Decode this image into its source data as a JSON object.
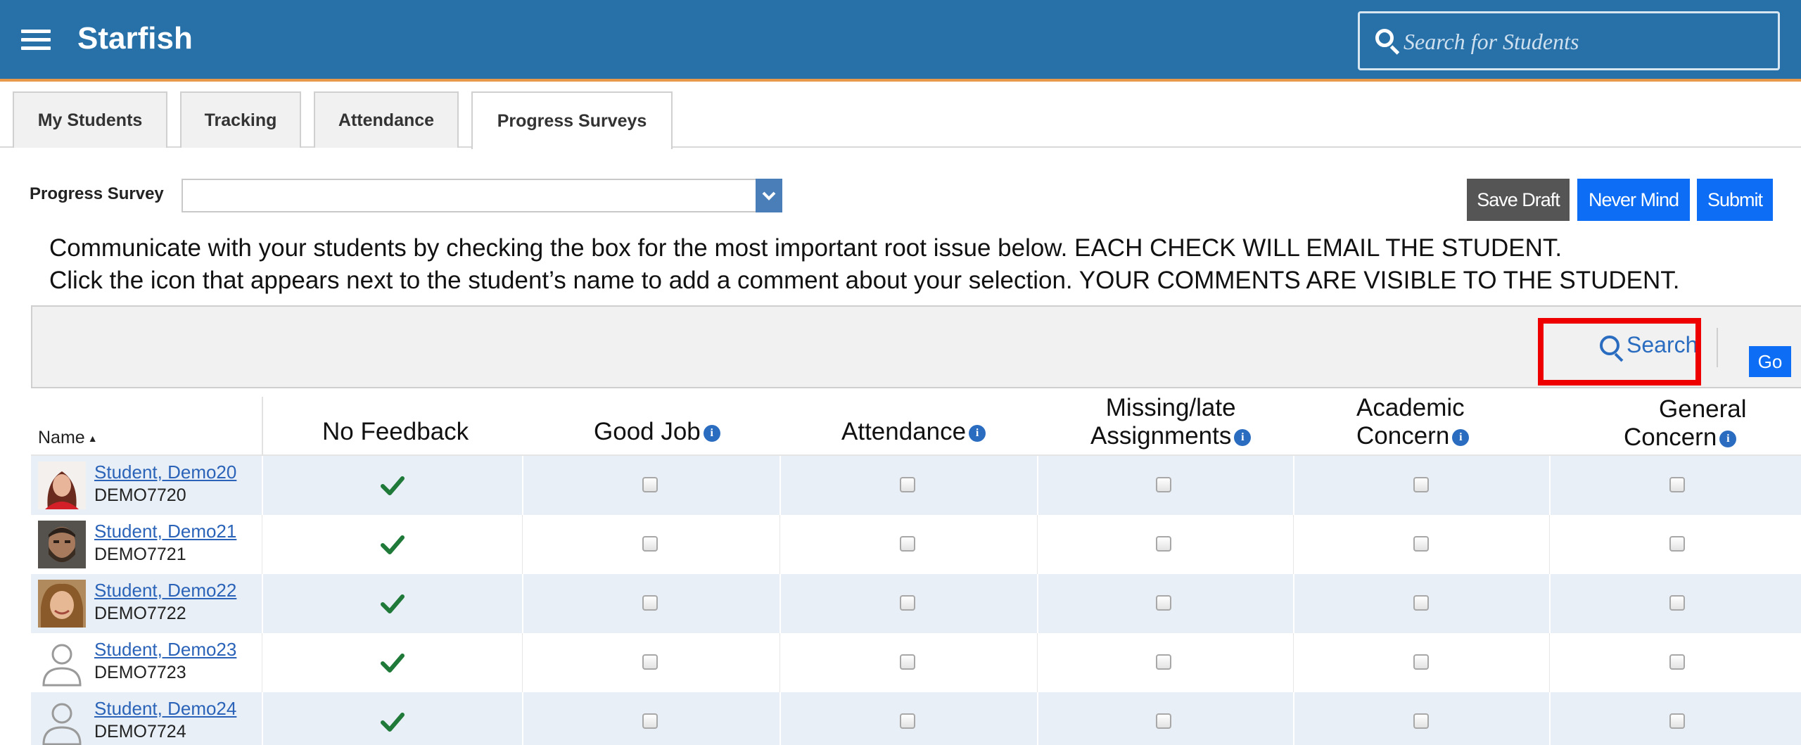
{
  "app": {
    "title": "Starfish",
    "search_placeholder": "Search for Students",
    "accent_color": "#2771a8"
  },
  "tabs": [
    {
      "label": "My Students",
      "active": false
    },
    {
      "label": "Tracking",
      "active": false
    },
    {
      "label": "Attendance",
      "active": false
    },
    {
      "label": "Progress Surveys",
      "active": true
    }
  ],
  "survey": {
    "label": "Progress Survey",
    "selected_value": ""
  },
  "buttons": {
    "save_draft": "Save Draft",
    "never_mind": "Never Mind",
    "submit": "Submit"
  },
  "instructions": {
    "line1": "Communicate with your students by checking the box for the most important root issue below. EACH CHECK WILL EMAIL THE STUDENT.",
    "line2": "Click the icon that appears next to the student’s name to add a comment about your selection. YOUR COMMENTS ARE VISIBLE TO THE STUDENT."
  },
  "filter": {
    "search_label": "Search",
    "go_label": "Go"
  },
  "table": {
    "columns": {
      "name": "Name",
      "no_feedback": "No Feedback",
      "good_job": "Good Job",
      "attendance": "Attendance",
      "missing_line1": "Missing/late",
      "missing_line2": "Assignments",
      "academic_line1": "Academic",
      "academic_line2": "Concern",
      "general_line1": "General",
      "general_line2": "Concern"
    },
    "rows": [
      {
        "name": "Student, Demo20",
        "id": "DEMO7720",
        "avatar": "photo-woman-red",
        "no_feedback": true
      },
      {
        "name": "Student, Demo21",
        "id": "DEMO7721",
        "avatar": "photo-man-beard",
        "no_feedback": true
      },
      {
        "name": "Student, Demo22",
        "id": "DEMO7722",
        "avatar": "photo-woman-smile",
        "no_feedback": true
      },
      {
        "name": "Student, Demo23",
        "id": "DEMO7723",
        "avatar": "default-user-icon",
        "no_feedback": true
      },
      {
        "name": "Student, Demo24",
        "id": "DEMO7724",
        "avatar": "default-user-icon",
        "no_feedback": true
      }
    ]
  }
}
